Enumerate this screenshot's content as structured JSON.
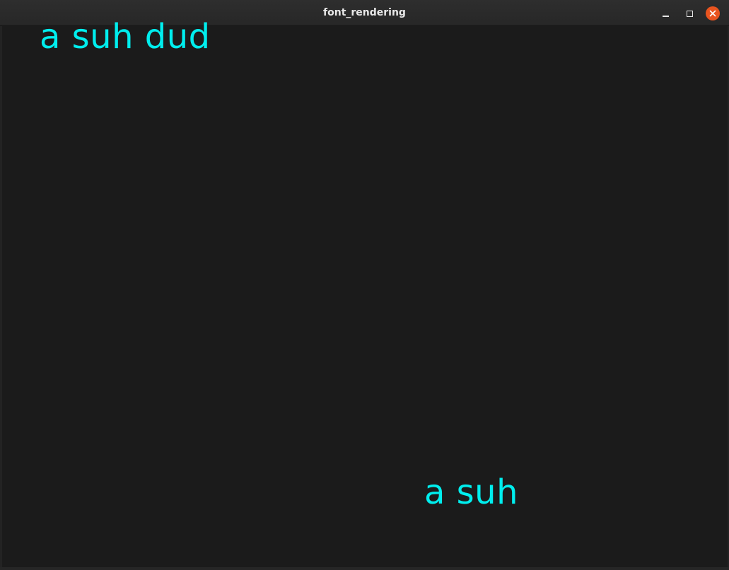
{
  "window": {
    "title": "font_rendering",
    "controls": {
      "minimize_icon": "minimize-icon",
      "maximize_icon": "maximize-icon",
      "close_icon": "close-icon"
    },
    "colors": {
      "close_button": "#e9541f",
      "background": "#1b1b1b"
    }
  },
  "canvas": {
    "texts": [
      "a suh dud",
      "a suh"
    ],
    "text_color": "#00eeee"
  }
}
